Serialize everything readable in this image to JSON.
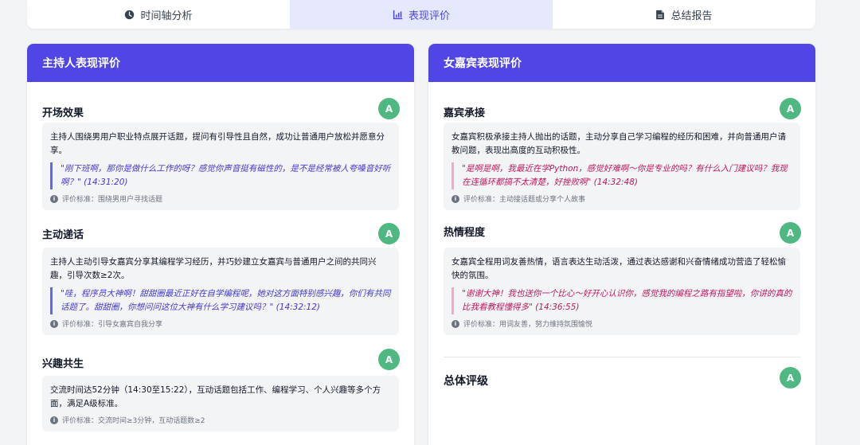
{
  "tabs": [
    {
      "label": "时间轴分析",
      "icon": "clock-icon"
    },
    {
      "label": "表现评价",
      "icon": "bar-chart-icon"
    },
    {
      "label": "总结报告",
      "icon": "document-icon"
    }
  ],
  "host": {
    "title": "主持人表现评价",
    "sections": [
      {
        "title": "开场效果",
        "grade": "A",
        "desc": "主持人围绕男用户职业特点展开话题，提问有引导性且自然，成功让普通用户放松并愿意分享。",
        "quote": "\"刚下班啊，那你是做什么工作的呀？感觉你声音挺有磁性的，是不是经常被人夸嗓音好听啊？\" (14:31:20)",
        "criteria": "评价标准：围绕男用户寻找话题"
      },
      {
        "title": "主动递话",
        "grade": "A",
        "desc": "主持人主动引导女嘉宾分享其编程学习经历，并巧妙建立女嘉宾与普通用户之间的共同兴趣，引导次数≥2次。",
        "quote": "\"哇，程序员大神啊！甜甜圈最近正好在自学编程呢，她对这方面特别感兴趣，你们有共同话题了。甜甜圈，你想问问这位大神有什么学习建议吗？\" (14:32:12)",
        "criteria": "评价标准：引导女嘉宾自我分享"
      },
      {
        "title": "兴趣共生",
        "grade": "A",
        "desc": "交流时间达52分钟（14:30至15:22），互动话题包括工作、编程学习、个人兴趣等多个方面，满足A级标准。",
        "criteria": "评价标准：交流时间≥3分钟，互动话题数≥2"
      }
    ]
  },
  "guest": {
    "title": "女嘉宾表现评价",
    "sections": [
      {
        "title": "嘉宾承接",
        "grade": "A",
        "desc": "女嘉宾积极承接主持人抛出的话题，主动分享自己学习编程的经历和困难，并向普通用户请教问题，表现出高度的互动积极性。",
        "quote": "\"是啊是啊，我最近在学Python，感觉好难啊～你是专业的吗？有什么入门建议吗？我现在连循环都搞不太清楚，好挫败啊\" (14:32:48)",
        "criteria": "评价标准：主动接话题或分享个人故事"
      },
      {
        "title": "热情程度",
        "grade": "A",
        "desc": "女嘉宾全程用词友善热情，语言表达生动活泼，通过表达感谢和兴奋情绪成功营造了轻松愉快的氛围。",
        "quote": "\"谢谢大神！我也送你一个比心～好开心认识你，感觉我的编程之路有指望啦，你讲的真的比我看教程懂得多\" (14:36:55)",
        "criteria": "评价标准：用词友善，努力维持氛围愉悦"
      }
    ],
    "overall": {
      "title": "总体评级",
      "grade": "A"
    }
  }
}
